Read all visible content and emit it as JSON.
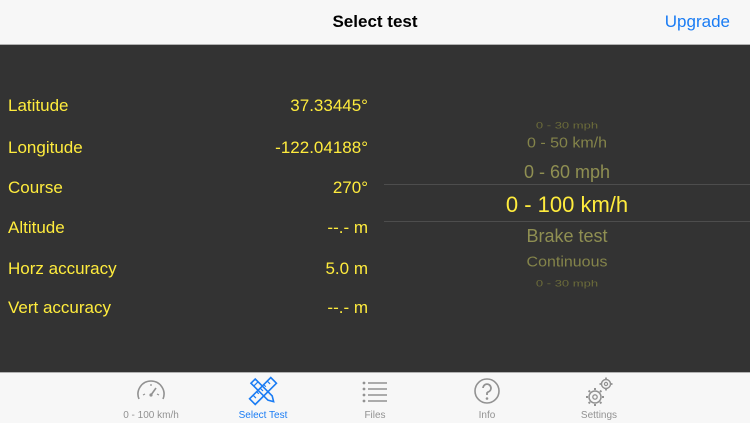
{
  "nav": {
    "title": "Select test",
    "upgrade": "Upgrade"
  },
  "info": [
    {
      "label": "Latitude",
      "value": "37.33445°"
    },
    {
      "label": "Longitude",
      "value": "-122.04188°"
    },
    {
      "label": "Course",
      "value": "270°"
    },
    {
      "label": "Altitude",
      "value": "--.- m"
    },
    {
      "label": "Horz accuracy",
      "value": "5.0 m"
    },
    {
      "label": "Vert accuracy",
      "value": "--.- m"
    }
  ],
  "picker": {
    "options": [
      "0 - 30 mph",
      "0 - 50 km/h",
      "0 - 60 mph",
      "0 - 100 km/h",
      "Brake test",
      "Continuous",
      "0 - 30 mph"
    ],
    "selected": "0 - 100 km/h"
  },
  "tabs": [
    {
      "label": "0 - 100 km/h",
      "icon": "speedometer-icon",
      "active": false
    },
    {
      "label": "Select Test",
      "icon": "ruler-pencil-icon",
      "active": true
    },
    {
      "label": "Files",
      "icon": "list-icon",
      "active": false
    },
    {
      "label": "Info",
      "icon": "question-icon",
      "active": false
    },
    {
      "label": "Settings",
      "icon": "gears-icon",
      "active": false
    }
  ],
  "colors": {
    "accent": "#1a7cf4",
    "info_text": "#ffec3d",
    "background": "#333333"
  }
}
